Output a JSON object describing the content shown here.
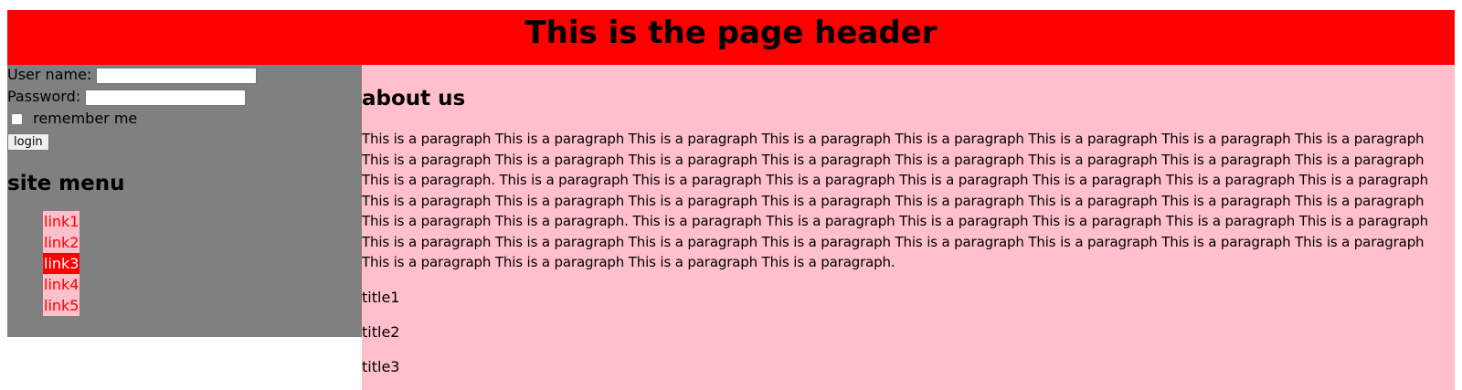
{
  "header": {
    "title": "This is the page header"
  },
  "login_form": {
    "username_label": "User name:",
    "username_value": "",
    "password_label": "Password:",
    "password_value": "",
    "remember_label": "remember me",
    "remember_checked": false,
    "login_button": "login"
  },
  "site_menu": {
    "heading": "site menu",
    "links": [
      {
        "label": "link1",
        "active": false
      },
      {
        "label": "link2",
        "active": false
      },
      {
        "label": "link3",
        "active": true
      },
      {
        "label": "link4",
        "active": false
      },
      {
        "label": "link5",
        "active": false
      }
    ]
  },
  "main": {
    "heading": "about us",
    "paragraph": "This is a paragraph This is a paragraph This is a paragraph This is a paragraph This is a paragraph This is a paragraph This is a paragraph This is a paragraph This is a paragraph This is a paragraph This is a paragraph This is a paragraph This is a paragraph This is a paragraph This is a paragraph This is a paragraph This is a paragraph. This is a paragraph This is a paragraph This is a paragraph This is a paragraph This is a paragraph This is a paragraph This is a paragraph This is a paragraph This is a paragraph This is a paragraph This is a paragraph This is a paragraph This is a paragraph This is a paragraph This is a paragraph This is a paragraph This is a paragraph. This is a paragraph This is a paragraph This is a paragraph This is a paragraph This is a paragraph This is a paragraph This is a paragraph This is a paragraph This is a paragraph This is a paragraph This is a paragraph This is a paragraph This is a paragraph This is a paragraph This is a paragraph This is a paragraph This is a paragraph This is a paragraph.",
    "titles": [
      "title1",
      "title2",
      "title3"
    ]
  },
  "colors": {
    "header_bg": "#ff0000",
    "sidebar_bg": "#808080",
    "content_bg": "#ffc0cb",
    "link_text": "#ff0000",
    "link_bg": "#ffc0cb",
    "active_link_bg": "#ff0000",
    "active_link_text": "#ffffff"
  }
}
